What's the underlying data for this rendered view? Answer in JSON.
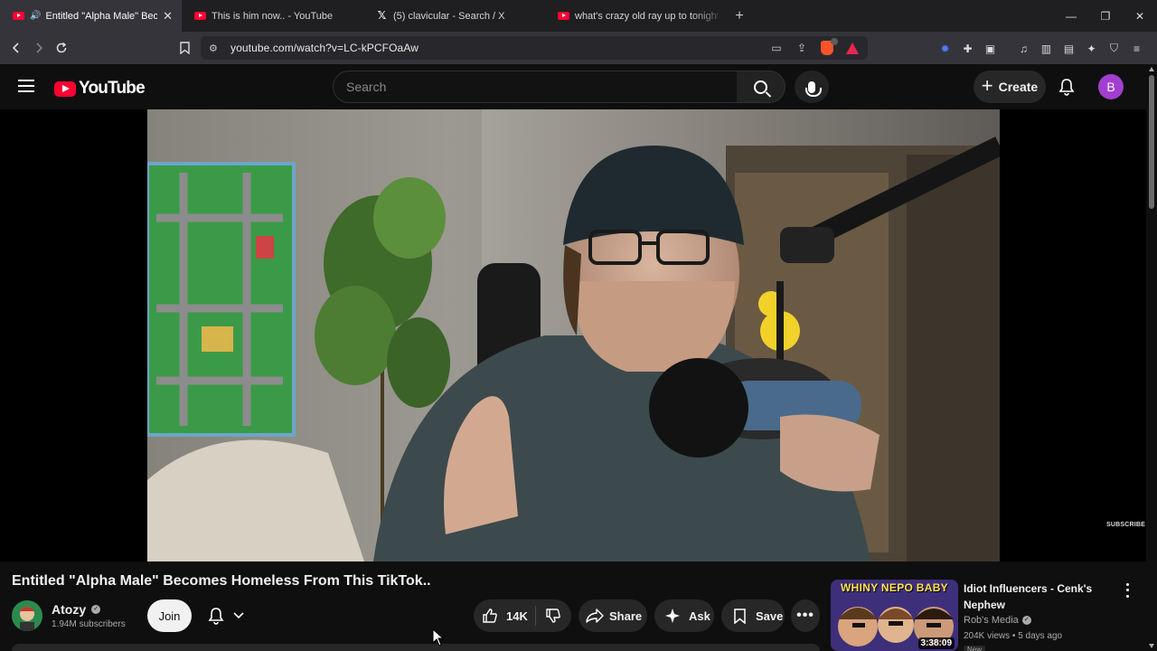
{
  "browser": {
    "tabs": [
      {
        "title": "Entitled \"Alpha Male\" Becomes Homeless From This TikTok..",
        "active": true,
        "audio": true
      },
      {
        "title": "This is him now.. - YouTube",
        "active": false
      },
      {
        "title": "(5) clavicular - Search / X",
        "active": false
      },
      {
        "title": "what's crazy old ray up to tonight? (g",
        "active": false
      }
    ],
    "url": "youtube.com/watch?v=LC-kPCFOaAw"
  },
  "header": {
    "logo_text": "YouTube",
    "search_placeholder": "Search",
    "create_label": "Create",
    "avatar_letter": "B"
  },
  "player": {
    "watermark": "SUBSCRIBE"
  },
  "video": {
    "title": "Entitled \"Alpha Male\" Becomes Homeless From This TikTok..",
    "channel": "Atozy",
    "subscribers": "1.94M subscribers",
    "join_label": "Join",
    "likes": "14K",
    "share_label": "Share",
    "ask_label": "Ask",
    "save_label": "Save"
  },
  "recommendation": {
    "thumb_text": "WHINY NEPO BABY",
    "duration": "3:38:09",
    "title": "Idiot Influencers - Cenk's Nephew",
    "channel": "Rob's Media",
    "meta": "204K views • 5 days ago",
    "badge": "New"
  },
  "colors": {
    "accent_red": "#ff0033",
    "avatar_purple": "#a23fd0",
    "background": "#0f0f0f"
  }
}
